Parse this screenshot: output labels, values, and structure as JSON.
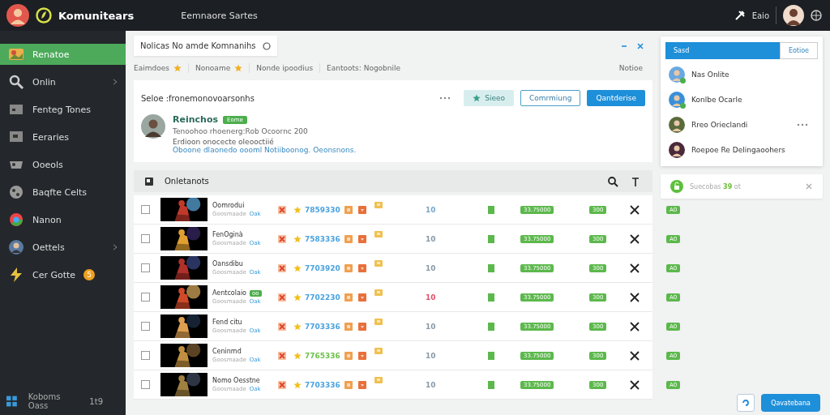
{
  "topbar": {
    "brand": "Komunitears",
    "title": "Eemnaore Sartes",
    "user_label": "Eaio"
  },
  "sidebar": {
    "items": [
      {
        "label": "Renatoe",
        "selected": true,
        "chevron": false
      },
      {
        "label": "Onlin",
        "selected": false,
        "chevron": true
      },
      {
        "label": "Fenteg Tones",
        "selected": false,
        "chevron": false
      },
      {
        "label": "Eeraries",
        "selected": false,
        "chevron": false
      },
      {
        "label": "Ooeols",
        "selected": false,
        "chevron": false
      },
      {
        "label": "Baqfte Celts",
        "selected": false,
        "chevron": false
      },
      {
        "label": "Nanon",
        "selected": false,
        "chevron": false
      },
      {
        "label": "Oettels",
        "selected": false,
        "chevron": true
      },
      {
        "label": "Cer Gotte",
        "selected": false,
        "chevron": false,
        "badge": "5"
      }
    ],
    "footer": {
      "label": "Koboms Oass",
      "count": "1t9"
    }
  },
  "notice": {
    "text": "Nolicas No amde Komnanihs"
  },
  "filters": [
    {
      "label": "Eaimdoes",
      "starred": true
    },
    {
      "label": "Nonoame",
      "starred": true
    },
    {
      "label": "Nonde ipoodius",
      "starred": false
    },
    {
      "label": "Eantoots: Nogobnile",
      "starred": false
    }
  ],
  "filters_end": "Notioe",
  "card": {
    "title": "Seloe :fronemonovoarsonhs",
    "buttons": [
      {
        "label": "Sieeo",
        "kind": "soft"
      },
      {
        "label": "Comrmiung",
        "kind": "outline"
      },
      {
        "label": "Qantderise",
        "kind": "primary"
      }
    ],
    "profile": {
      "name": "Reinchos",
      "badge": "Eome",
      "line": "Tenoohoo rhoenerg:Rob Ocoornc 200",
      "desc": "Erdioon onocecte oleooctiié",
      "link": "Oboone dlaonedo oooml Notiiboonog. Oeonsnons."
    }
  },
  "table": {
    "title": "Onletanots",
    "rows": [
      {
        "name": "Oomrodui",
        "sub": "Goosmaade",
        "tag": "Oak",
        "checked": false,
        "score": {
          "text": "7859330",
          "color": "#4aa3df"
        },
        "count": {
          "text": "10",
          "color": "#7aa7c7"
        },
        "amount": "33.75000",
        "qty": "300",
        "extra": "A0"
      },
      {
        "name": "FenOginà",
        "sub": "Goosmaade",
        "tag": "Oak",
        "checked": false,
        "score": {
          "text": "7583336",
          "color": "#4aa3df"
        },
        "count": {
          "text": "10",
          "color": "#8a9aa8"
        },
        "amount": "33.75000",
        "qty": "300",
        "extra": "A0"
      },
      {
        "name": "Oansdibu",
        "sub": "Goosmaade",
        "tag": "Oak",
        "checked": false,
        "score": {
          "text": "7703920",
          "color": "#4aa3df"
        },
        "count": {
          "text": "10",
          "color": "#8a9aa8"
        },
        "amount": "33.75000",
        "qty": "300",
        "extra": "A0"
      },
      {
        "name": "Aentcolaio",
        "badge": "oo",
        "sub": "Goosmaade",
        "tag": "Oak",
        "checked": false,
        "score": {
          "text": "7702230",
          "color": "#4aa3df"
        },
        "count": {
          "text": "10",
          "color": "#e0506a"
        },
        "amount": "33.75000",
        "qty": "300",
        "extra": "A0"
      },
      {
        "name": "Fend citu",
        "sub": "Goosmaade",
        "tag": "Oak",
        "checked": false,
        "score": {
          "text": "7703336",
          "color": "#4aa3df"
        },
        "count": {
          "text": "10",
          "color": "#8a9aa8"
        },
        "amount": "33.75000",
        "qty": "300",
        "extra": "A0"
      },
      {
        "name": "Ceninmd",
        "sub": "Goosmaade",
        "tag": "Oak",
        "checked": false,
        "score": {
          "text": "7765336",
          "color": "#6cc04a"
        },
        "count": {
          "text": "10",
          "color": "#8a9aa8"
        },
        "amount": "33.75000",
        "qty": "300",
        "extra": "A0"
      },
      {
        "name": "Nomo Oesstne",
        "sub": "Goosmaade",
        "tag": "Oak",
        "checked": false,
        "score": {
          "text": "7703336",
          "color": "#4aa3df"
        },
        "count": {
          "text": "10",
          "color": "#8a9aa8"
        },
        "amount": "33.75000",
        "qty": "300",
        "extra": "A0"
      }
    ]
  },
  "dropdown": {
    "search": "Sasd",
    "button": "Eotioe",
    "items": [
      {
        "name": "Nas Onlite",
        "online": true,
        "menu": false
      },
      {
        "name": "Konlbe Ocarle",
        "online": true,
        "menu": false
      },
      {
        "name": "Rreo Orieclandi",
        "online": false,
        "menu": true
      },
      {
        "name": "Roepoe Re Delingaoohers",
        "online": false,
        "menu": false
      }
    ]
  },
  "toast": {
    "text": "Suecobas",
    "count": "39",
    "suffix": "ot"
  },
  "footer_button": "Qavatebana"
}
